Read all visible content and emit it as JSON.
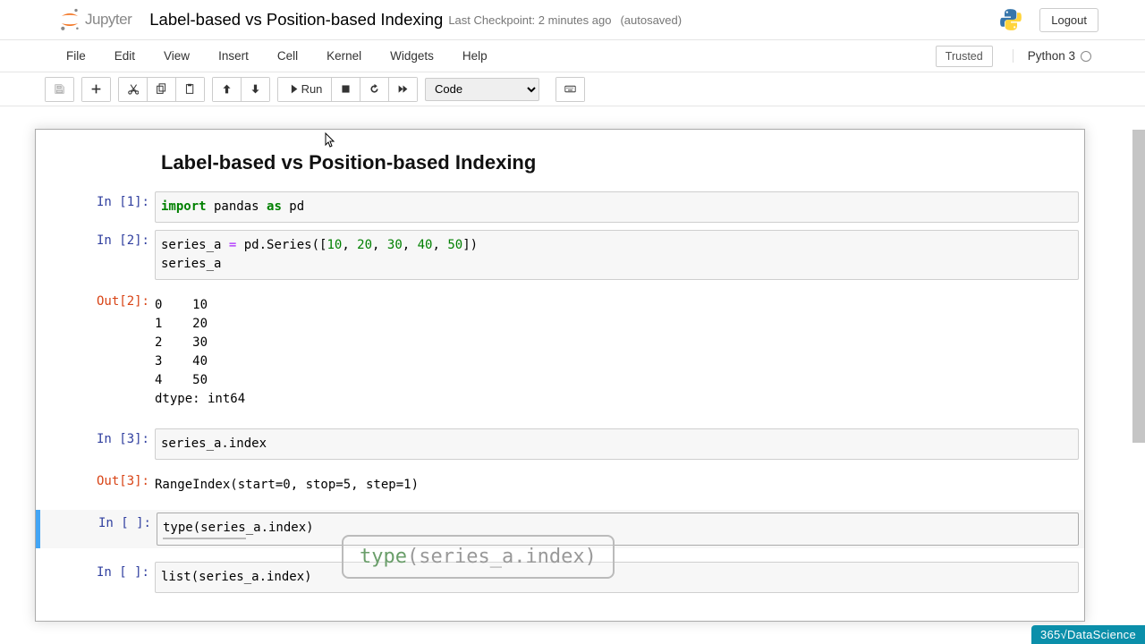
{
  "header": {
    "logo_text": "Jupyter",
    "title": "Label-based vs Position-based Indexing",
    "checkpoint": "Last Checkpoint: 2 minutes ago",
    "autosaved": "(autosaved)",
    "logout": "Logout"
  },
  "menubar": {
    "items": [
      "File",
      "Edit",
      "View",
      "Insert",
      "Cell",
      "Kernel",
      "Widgets",
      "Help"
    ],
    "trusted": "Trusted",
    "kernel": "Python 3"
  },
  "toolbar": {
    "run_label": "Run",
    "cell_type": "Code"
  },
  "notebook": {
    "heading": "Label-based vs Position-based Indexing",
    "cells": [
      {
        "prompt_in": "In [1]:",
        "code_html": "<span class='kw'>import</span> pandas <span class='kw2'>as</span> pd"
      },
      {
        "prompt_in": "In [2]:",
        "code_html": "series_a <span class='op'>=</span> pd.Series([<span class='num'>10</span>, <span class='num'>20</span>, <span class='num'>30</span>, <span class='num'>40</span>, <span class='num'>50</span>])\nseries_a",
        "prompt_out": "Out[2]:",
        "output": "0    10\n1    20\n2    30\n3    40\n4    50\ndtype: int64"
      },
      {
        "prompt_in": "In [3]:",
        "code_html": "series_a.index",
        "prompt_out": "Out[3]:",
        "output": "RangeIndex(start=0, stop=5, step=1)"
      },
      {
        "prompt_in": "In [ ]:",
        "code_html": "<span class='underline-dec'>type(series</span>_a.index)",
        "selected": true
      },
      {
        "prompt_in": "In [ ]:",
        "code_html": "list(series_a.index)"
      }
    ]
  },
  "overlay": {
    "text_kw": "type",
    "text_rest": "(series_a.index)"
  },
  "watermark": "365√DataScience"
}
